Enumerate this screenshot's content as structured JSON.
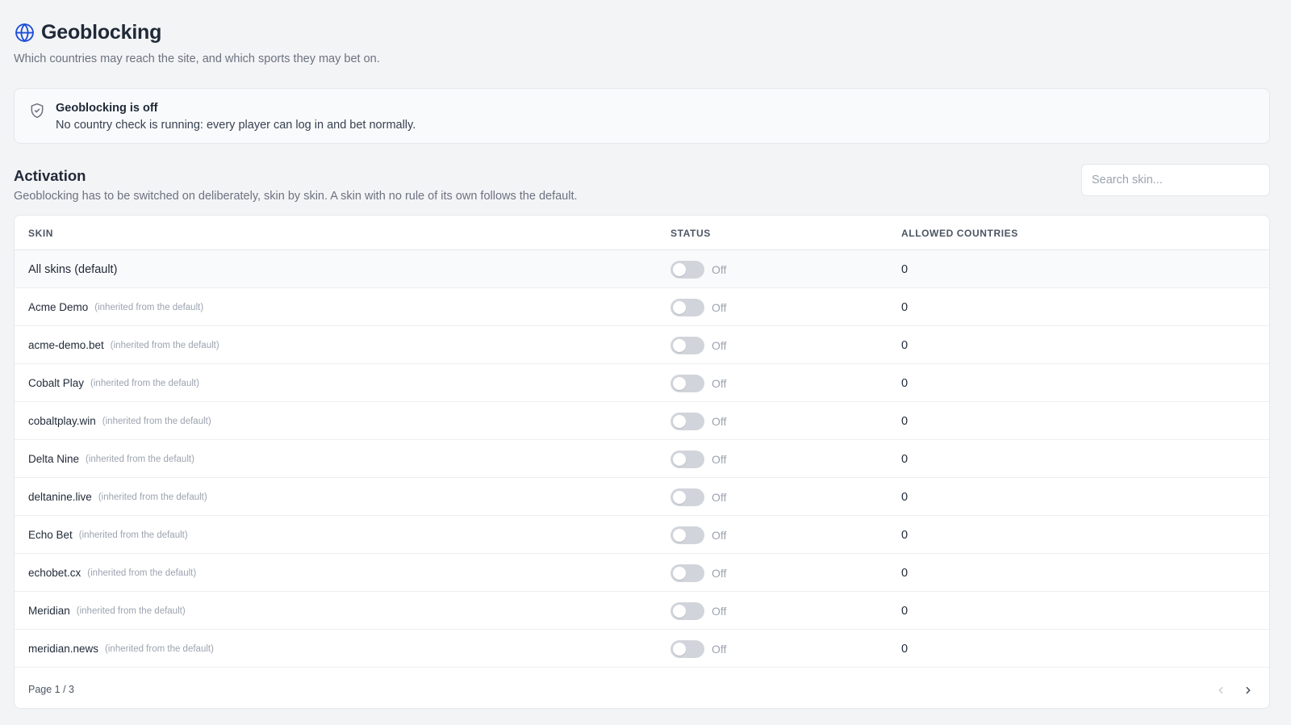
{
  "header": {
    "title": "Geoblocking",
    "subtitle": "Which countries may reach the site, and which sports they may bet on."
  },
  "notice": {
    "title": "Geoblocking is off",
    "text": "No country check is running: every player can log in and bet normally."
  },
  "activation": {
    "title": "Activation",
    "description": "Geoblocking has to be switched on deliberately, skin by skin. A skin with no rule of its own follows the default.",
    "search_placeholder": "Search skin..."
  },
  "table": {
    "headers": {
      "skin": "SKIN",
      "status": "STATUS",
      "allowed": "ALLOWED COUNTRIES"
    },
    "rows": [
      {
        "skin": "All skins (default)",
        "note": "",
        "status": "Off",
        "enabled": false,
        "allowed": "0"
      },
      {
        "skin": "Acme Demo",
        "note": "(inherited from the default)",
        "status": "Off",
        "enabled": false,
        "allowed": "0"
      },
      {
        "skin": "acme-demo.bet",
        "note": "(inherited from the default)",
        "status": "Off",
        "enabled": false,
        "allowed": "0"
      },
      {
        "skin": "Cobalt Play",
        "note": "(inherited from the default)",
        "status": "Off",
        "enabled": false,
        "allowed": "0"
      },
      {
        "skin": "cobaltplay.win",
        "note": "(inherited from the default)",
        "status": "Off",
        "enabled": false,
        "allowed": "0"
      },
      {
        "skin": "Delta Nine",
        "note": "(inherited from the default)",
        "status": "Off",
        "enabled": false,
        "allowed": "0"
      },
      {
        "skin": "deltanine.live",
        "note": "(inherited from the default)",
        "status": "Off",
        "enabled": false,
        "allowed": "0"
      },
      {
        "skin": "Echo Bet",
        "note": "(inherited from the default)",
        "status": "Off",
        "enabled": false,
        "allowed": "0"
      },
      {
        "skin": "echobet.cx",
        "note": "(inherited from the default)",
        "status": "Off",
        "enabled": false,
        "allowed": "0"
      },
      {
        "skin": "Meridian",
        "note": "(inherited from the default)",
        "status": "Off",
        "enabled": false,
        "allowed": "0"
      },
      {
        "skin": "meridian.news",
        "note": "(inherited from the default)",
        "status": "Off",
        "enabled": false,
        "allowed": "0"
      }
    ]
  },
  "pagination": {
    "label": "Page 1 / 3"
  },
  "colors": {
    "accent": "#1d4ed8",
    "toggle_off": "#d1d5db",
    "muted_text": "#9ca3af"
  },
  "icons": {
    "title": "globe-icon",
    "notice": "shield-check-icon",
    "prev": "chevron-left-icon",
    "next": "chevron-right-icon"
  }
}
